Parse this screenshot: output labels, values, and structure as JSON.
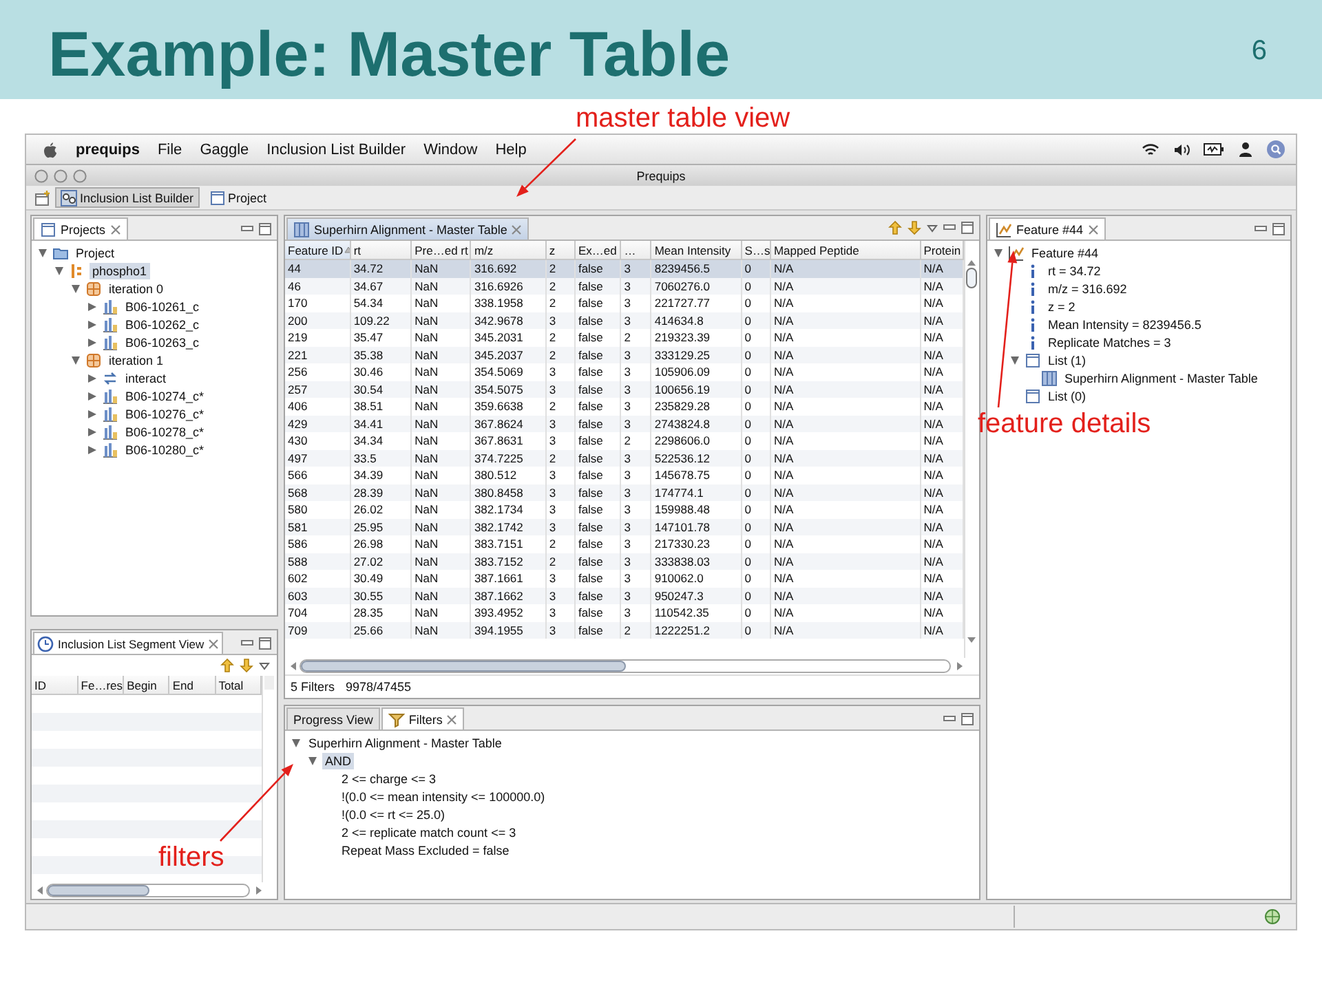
{
  "slide": {
    "title": "Example: Master Table",
    "page_number": "6"
  },
  "annotations": [
    {
      "text": "master table view"
    },
    {
      "text": "feature details"
    },
    {
      "text": "filters"
    }
  ],
  "menu_bar": {
    "app": "prequips",
    "items": [
      "File",
      "Gaggle",
      "Inclusion List Builder",
      "Window",
      "Help"
    ]
  },
  "window": {
    "title": "Prequips"
  },
  "perspectives": [
    {
      "label": "Inclusion List Builder",
      "selected": true
    },
    {
      "label": "Project",
      "selected": false
    }
  ],
  "projects_view": {
    "tab": "Projects",
    "tree": [
      {
        "label": "Project",
        "kind": "folder",
        "expanded": true,
        "selected": false,
        "children": [
          {
            "label": "phospho1",
            "kind": "project",
            "expanded": true,
            "selected": true,
            "children": [
              {
                "label": "iteration 0",
                "kind": "iteration",
                "expanded": true,
                "selected": false,
                "children": [
                  {
                    "label": "B06-10261_c",
                    "kind": "dataset",
                    "expanded": false,
                    "selected": false
                  },
                  {
                    "label": "B06-10262_c",
                    "kind": "dataset",
                    "expanded": false,
                    "selected": false
                  },
                  {
                    "label": "B06-10263_c",
                    "kind": "dataset",
                    "expanded": false,
                    "selected": false
                  }
                ]
              },
              {
                "label": "iteration 1",
                "kind": "iteration",
                "expanded": true,
                "selected": false,
                "children": [
                  {
                    "label": "interact",
                    "kind": "interact",
                    "expanded": false,
                    "selected": false
                  },
                  {
                    "label": "B06-10274_c*",
                    "kind": "dataset",
                    "expanded": false,
                    "selected": false
                  },
                  {
                    "label": "B06-10276_c*",
                    "kind": "dataset",
                    "expanded": false,
                    "selected": false
                  },
                  {
                    "label": "B06-10278_c*",
                    "kind": "dataset",
                    "expanded": false,
                    "selected": false
                  },
                  {
                    "label": "B06-10280_c*",
                    "kind": "dataset",
                    "expanded": false,
                    "selected": false
                  }
                ]
              }
            ]
          }
        ]
      }
    ]
  },
  "segment_view": {
    "tab": "Inclusion List Segment View",
    "columns": [
      "ID",
      "Fe…res",
      "Begin",
      "End",
      "Total"
    ]
  },
  "master_table": {
    "tab": "Superhirn Alignment - Master Table",
    "columns": [
      {
        "label": "Feature ID",
        "sorted": true
      },
      {
        "label": "rt",
        "sorted": false
      },
      {
        "label": "Pre…ed rt",
        "sorted": false
      },
      {
        "label": "m/z",
        "sorted": false
      },
      {
        "label": "z",
        "sorted": false
      },
      {
        "label": "Ex…ed",
        "sorted": false
      },
      {
        "label": "…",
        "sorted": false
      },
      {
        "label": "Mean Intensity",
        "sorted": false
      },
      {
        "label": "S…s",
        "sorted": false
      },
      {
        "label": "Mapped Peptide",
        "sorted": false
      },
      {
        "label": "Protein",
        "sorted": false
      }
    ],
    "rows": [
      {
        "selected": true,
        "cells": [
          "44",
          "34.72",
          "NaN",
          "316.692",
          "2",
          "false",
          "3",
          "8239456.5",
          "0",
          "N/A",
          "N/A"
        ]
      },
      {
        "selected": false,
        "cells": [
          "46",
          "34.67",
          "NaN",
          "316.6926",
          "2",
          "false",
          "3",
          "7060276.0",
          "0",
          "N/A",
          "N/A"
        ]
      },
      {
        "selected": false,
        "cells": [
          "170",
          "54.34",
          "NaN",
          "338.1958",
          "2",
          "false",
          "3",
          "221727.77",
          "0",
          "N/A",
          "N/A"
        ]
      },
      {
        "selected": false,
        "cells": [
          "200",
          "109.22",
          "NaN",
          "342.9678",
          "3",
          "false",
          "3",
          "414634.8",
          "0",
          "N/A",
          "N/A"
        ]
      },
      {
        "selected": false,
        "cells": [
          "219",
          "35.47",
          "NaN",
          "345.2031",
          "2",
          "false",
          "2",
          "219323.39",
          "0",
          "N/A",
          "N/A"
        ]
      },
      {
        "selected": false,
        "cells": [
          "221",
          "35.38",
          "NaN",
          "345.2037",
          "2",
          "false",
          "3",
          "333129.25",
          "0",
          "N/A",
          "N/A"
        ]
      },
      {
        "selected": false,
        "cells": [
          "256",
          "30.46",
          "NaN",
          "354.5069",
          "3",
          "false",
          "3",
          "105906.09",
          "0",
          "N/A",
          "N/A"
        ]
      },
      {
        "selected": false,
        "cells": [
          "257",
          "30.54",
          "NaN",
          "354.5075",
          "3",
          "false",
          "3",
          "100656.19",
          "0",
          "N/A",
          "N/A"
        ]
      },
      {
        "selected": false,
        "cells": [
          "406",
          "38.51",
          "NaN",
          "359.6638",
          "2",
          "false",
          "3",
          "235829.28",
          "0",
          "N/A",
          "N/A"
        ]
      },
      {
        "selected": false,
        "cells": [
          "429",
          "34.41",
          "NaN",
          "367.8624",
          "3",
          "false",
          "3",
          "2743824.8",
          "0",
          "N/A",
          "N/A"
        ]
      },
      {
        "selected": false,
        "cells": [
          "430",
          "34.34",
          "NaN",
          "367.8631",
          "3",
          "false",
          "2",
          "2298606.0",
          "0",
          "N/A",
          "N/A"
        ]
      },
      {
        "selected": false,
        "cells": [
          "497",
          "33.5",
          "NaN",
          "374.7225",
          "2",
          "false",
          "3",
          "522536.12",
          "0",
          "N/A",
          "N/A"
        ]
      },
      {
        "selected": false,
        "cells": [
          "566",
          "34.39",
          "NaN",
          "380.512",
          "3",
          "false",
          "3",
          "145678.75",
          "0",
          "N/A",
          "N/A"
        ]
      },
      {
        "selected": false,
        "cells": [
          "568",
          "28.39",
          "NaN",
          "380.8458",
          "3",
          "false",
          "3",
          "174774.1",
          "0",
          "N/A",
          "N/A"
        ]
      },
      {
        "selected": false,
        "cells": [
          "580",
          "26.02",
          "NaN",
          "382.1734",
          "3",
          "false",
          "3",
          "159988.48",
          "0",
          "N/A",
          "N/A"
        ]
      },
      {
        "selected": false,
        "cells": [
          "581",
          "25.95",
          "NaN",
          "382.1742",
          "3",
          "false",
          "3",
          "147101.78",
          "0",
          "N/A",
          "N/A"
        ]
      },
      {
        "selected": false,
        "cells": [
          "586",
          "26.98",
          "NaN",
          "383.7151",
          "2",
          "false",
          "3",
          "217330.23",
          "0",
          "N/A",
          "N/A"
        ]
      },
      {
        "selected": false,
        "cells": [
          "588",
          "27.02",
          "NaN",
          "383.7152",
          "2",
          "false",
          "3",
          "333838.03",
          "0",
          "N/A",
          "N/A"
        ]
      },
      {
        "selected": false,
        "cells": [
          "602",
          "30.49",
          "NaN",
          "387.1661",
          "3",
          "false",
          "3",
          "910062.0",
          "0",
          "N/A",
          "N/A"
        ]
      },
      {
        "selected": false,
        "cells": [
          "603",
          "30.55",
          "NaN",
          "387.1662",
          "3",
          "false",
          "3",
          "950247.3",
          "0",
          "N/A",
          "N/A"
        ]
      },
      {
        "selected": false,
        "cells": [
          "704",
          "28.35",
          "NaN",
          "393.4952",
          "3",
          "false",
          "3",
          "110542.35",
          "0",
          "N/A",
          "N/A"
        ]
      },
      {
        "selected": false,
        "cells": [
          "709",
          "25.66",
          "NaN",
          "394.1955",
          "3",
          "false",
          "2",
          "1222251.2",
          "0",
          "N/A",
          "N/A"
        ]
      }
    ],
    "filter_count": "5 Filters",
    "row_count": "9978/47455"
  },
  "filters_view": {
    "tabs": [
      {
        "label": "Progress View",
        "selected": false
      },
      {
        "label": "Filters",
        "selected": true
      }
    ],
    "tree": [
      {
        "label": "Superhirn Alignment - Master Table",
        "expanded": true,
        "selected": false,
        "children": [
          {
            "label": "AND",
            "expanded": true,
            "selected": true,
            "children": [
              {
                "label": "2 <= charge <= 3",
                "selected": false
              },
              {
                "label": "!(0.0 <= mean intensity <= 100000.0)",
                "selected": false
              },
              {
                "label": "!(0.0 <= rt <= 25.0)",
                "selected": false
              },
              {
                "label": "2 <= replicate match count <= 3",
                "selected": false
              },
              {
                "label": "Repeat Mass Excluded = false",
                "selected": false
              }
            ]
          }
        ]
      }
    ]
  },
  "feature_view": {
    "tab": "Feature #44",
    "tree": [
      {
        "label": "Feature #44",
        "kind": "feature",
        "expanded": true,
        "children": [
          {
            "label": "rt = 34.72",
            "kind": "info"
          },
          {
            "label": "m/z = 316.692",
            "kind": "info"
          },
          {
            "label": "z = 2",
            "kind": "info"
          },
          {
            "label": "Mean Intensity = 8239456.5",
            "kind": "info"
          },
          {
            "label": "Replicate Matches = 3",
            "kind": "info"
          },
          {
            "label": "List (1)",
            "kind": "list",
            "expanded": true,
            "children": [
              {
                "label": "Superhirn Alignment - Master Table",
                "kind": "table"
              }
            ]
          },
          {
            "label": "List (0)",
            "kind": "list"
          }
        ]
      }
    ]
  }
}
